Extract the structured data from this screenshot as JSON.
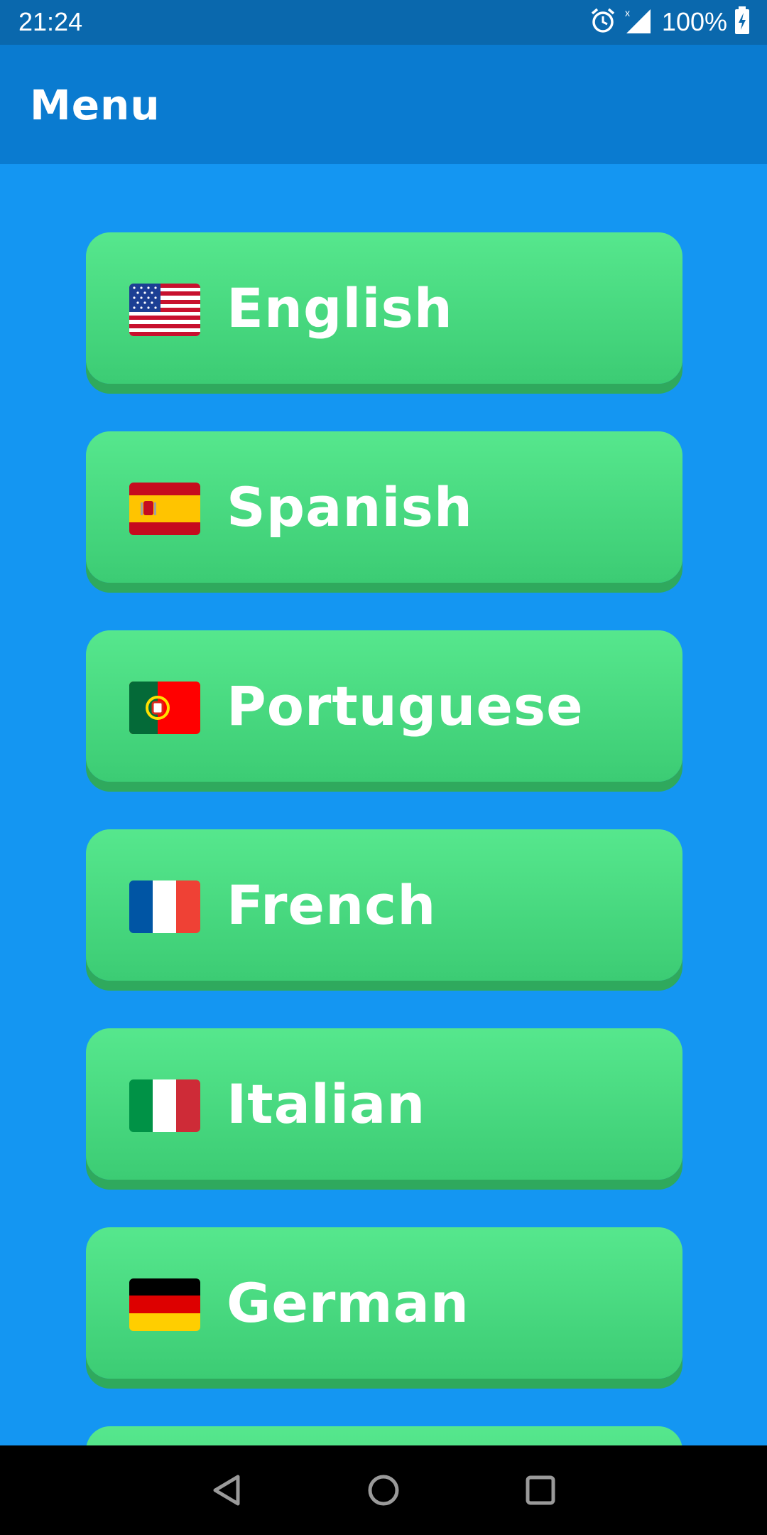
{
  "status_bar": {
    "time": "21:24",
    "battery": "100%",
    "icons": [
      "alarm-icon",
      "signal-icon",
      "battery-charging-icon"
    ]
  },
  "app_bar": {
    "title": "Menu",
    "color": "#0a7bd0"
  },
  "colors": {
    "background": "#1496f2",
    "button": "#4ddc83",
    "button_shadow": "#2fa95d",
    "status_bar": "#0a68ad"
  },
  "languages": [
    {
      "label": "English",
      "flag": "us-flag-icon"
    },
    {
      "label": "Spanish",
      "flag": "spain-flag-icon"
    },
    {
      "label": "Portuguese",
      "flag": "portugal-flag-icon"
    },
    {
      "label": "French",
      "flag": "france-flag-icon"
    },
    {
      "label": "Italian",
      "flag": "italy-flag-icon"
    },
    {
      "label": "German",
      "flag": "germany-flag-icon"
    }
  ],
  "nav_bar": {
    "icons": [
      "back-icon",
      "home-icon",
      "recents-icon"
    ]
  }
}
